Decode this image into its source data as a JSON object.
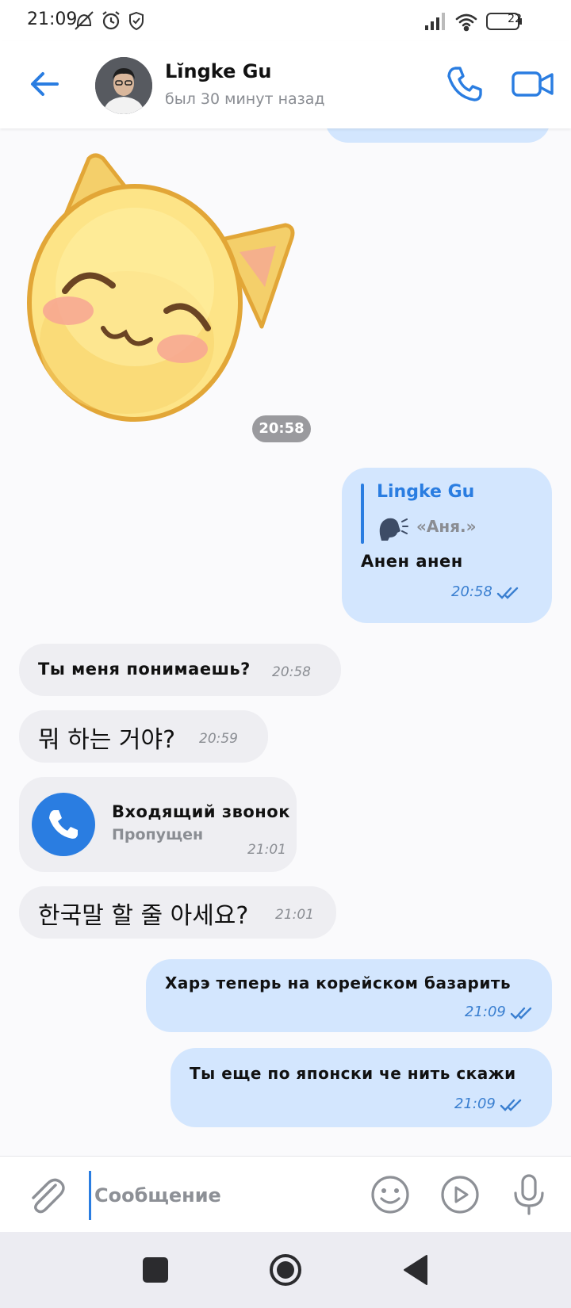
{
  "status_bar": {
    "time": "21:09",
    "left_icons": [
      "muted-bell-icon",
      "alarm-icon",
      "shield-icon"
    ],
    "right_icons": [
      "signal-icon",
      "wifi-icon",
      "battery-icon"
    ],
    "battery_level": "22"
  },
  "header": {
    "name": "Lĭngke Gu",
    "status": "был 30 минут назад",
    "icons": [
      "back-arrow-icon",
      "phone-icon",
      "video-camera-icon"
    ]
  },
  "messages": {
    "sticker": {
      "time": "20:58",
      "icon": "cat-sticker"
    },
    "reply": {
      "quoted_author": "Lingke Gu",
      "quoted_text": "«Аня.»",
      "quoted_icon": "speaking-head-emoji",
      "text": "Анен анен",
      "time": "20:58"
    },
    "in1": {
      "text": "Ты меня понимаешь?",
      "time": "20:58"
    },
    "in2": {
      "text": "뭐 하는 거야?",
      "time": "20:59"
    },
    "call": {
      "title": "Входящий звонок",
      "subtitle": "Пропущен",
      "time": "21:01",
      "icon": "phone-icon"
    },
    "in3": {
      "text": "한국말 할 줄 아세요?",
      "time": "21:01"
    },
    "out1": {
      "text": "Харэ теперь на корейском базарить",
      "time": "21:09"
    },
    "out2": {
      "text": "Ты еще по японски че нить скажи",
      "time": "21:09"
    }
  },
  "input": {
    "placeholder": "Сообщение",
    "icons": [
      "paperclip-icon",
      "smiley-icon",
      "play-circle-icon",
      "microphone-icon"
    ]
  },
  "colors": {
    "accent": "#2a7de1",
    "bubble_out": "#d3e6fe",
    "bubble_in": "#eeeef2",
    "chat_bg": "#fafafc"
  }
}
